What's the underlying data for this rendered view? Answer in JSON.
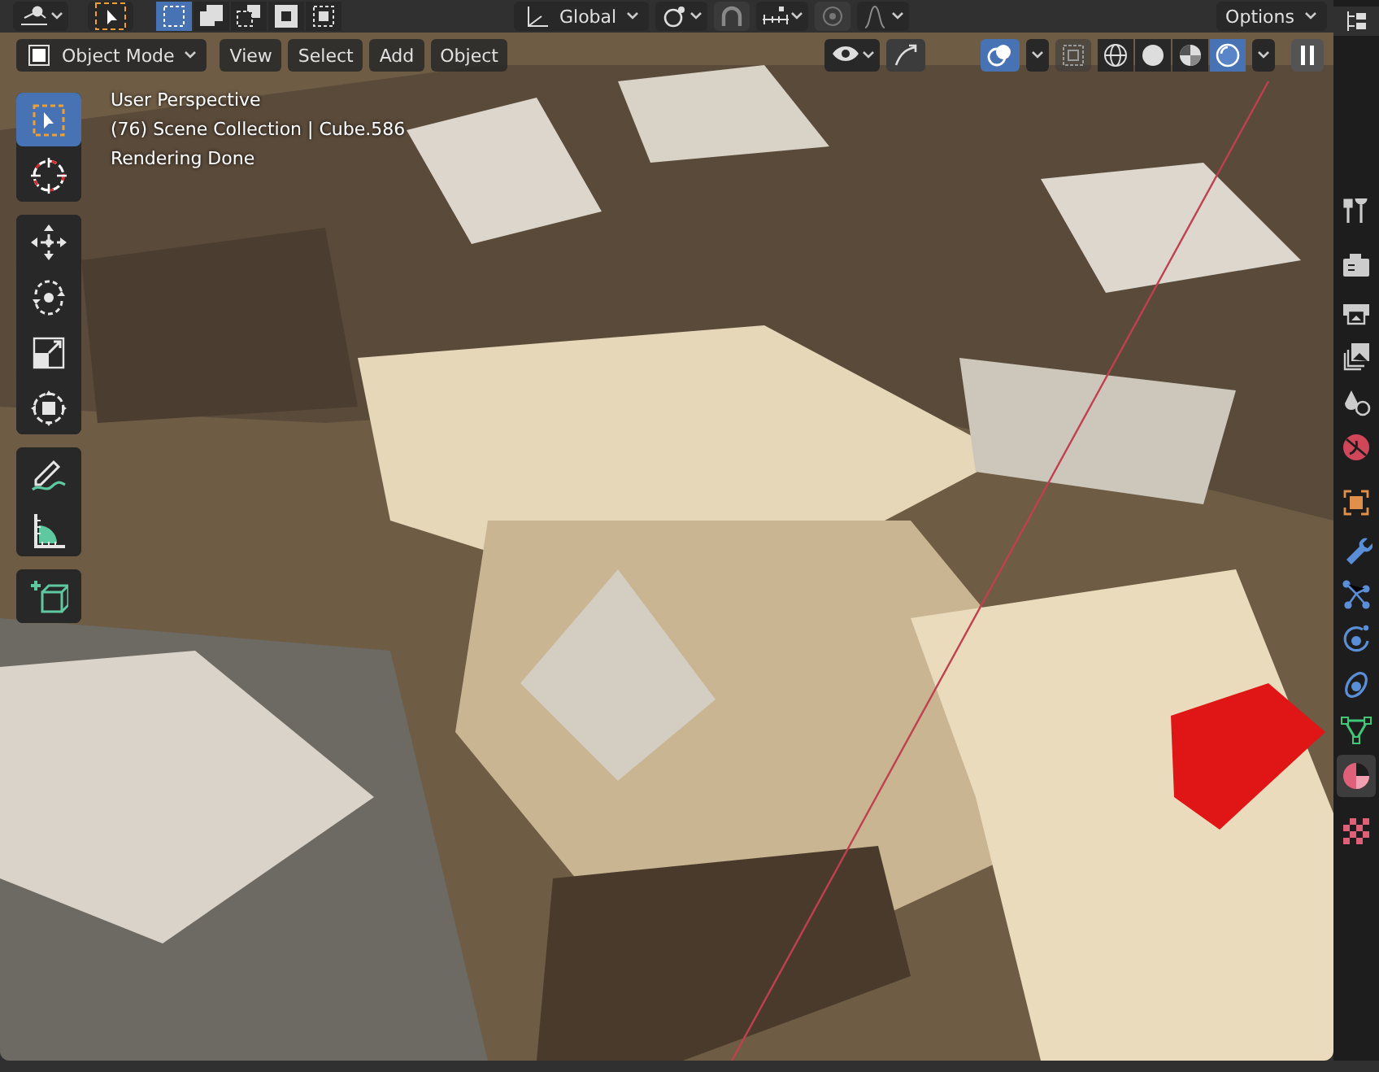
{
  "header": {
    "select_modes": [
      {
        "kind": "new",
        "selected": true
      },
      {
        "kind": "extend",
        "selected": false
      },
      {
        "kind": "subtract",
        "selected": false
      },
      {
        "kind": "invert",
        "selected": false
      },
      {
        "kind": "intersect",
        "selected": false
      }
    ],
    "transform_orientation": "Global",
    "options": "Options"
  },
  "viewport_header": {
    "mode": "Object Mode",
    "menus": [
      "View",
      "Select",
      "Add",
      "Object"
    ],
    "shading_modes": [
      {
        "kind": "wireframe",
        "selected": false
      },
      {
        "kind": "solid",
        "selected": false
      },
      {
        "kind": "material",
        "selected": false
      },
      {
        "kind": "rendered",
        "selected": true
      }
    ]
  },
  "overlay_text": [
    "User Perspective",
    "(76) Scene Collection | Cube.586",
    "Rendering Done"
  ],
  "tools": [
    {
      "kind": "select",
      "selected": true
    },
    {
      "kind": "cursor",
      "selected": false
    },
    {
      "kind": "move",
      "selected": false
    },
    {
      "kind": "rotate",
      "selected": false
    },
    {
      "kind": "scale",
      "selected": false
    },
    {
      "kind": "transform",
      "selected": false
    },
    {
      "kind": "annotate",
      "selected": false
    },
    {
      "kind": "measure",
      "selected": false
    },
    {
      "kind": "add-cube",
      "selected": false
    }
  ],
  "properties_tabs": [
    {
      "kind": "tool",
      "selected": false
    },
    {
      "kind": "render",
      "selected": false
    },
    {
      "kind": "output",
      "selected": false
    },
    {
      "kind": "view-layer",
      "selected": false
    },
    {
      "kind": "scene",
      "selected": false
    },
    {
      "kind": "world",
      "selected": false
    },
    {
      "kind": "object",
      "selected": false
    },
    {
      "kind": "modifiers",
      "selected": false
    },
    {
      "kind": "particles",
      "selected": false
    },
    {
      "kind": "physics",
      "selected": false
    },
    {
      "kind": "constraints",
      "selected": false
    },
    {
      "kind": "data",
      "selected": false
    },
    {
      "kind": "material",
      "selected": true
    },
    {
      "kind": "texture",
      "selected": false
    }
  ]
}
